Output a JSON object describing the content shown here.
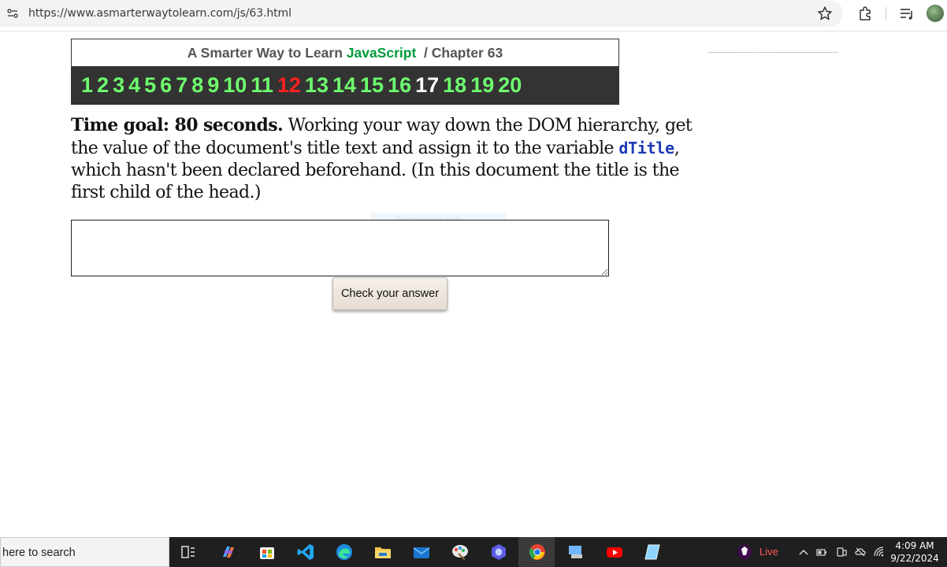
{
  "browser": {
    "url": "https://www.asmarterwaytolearn.com/js/63.html"
  },
  "header": {
    "title_prefix": "A Smarter Way to Learn ",
    "title_brand": "JavaScript",
    "title_suffix": "/  Chapter 63",
    "brand_color": "#009b3a"
  },
  "chapters": [
    {
      "label": "1",
      "state": "todo"
    },
    {
      "label": "2",
      "state": "todo"
    },
    {
      "label": "3",
      "state": "todo"
    },
    {
      "label": "4",
      "state": "todo"
    },
    {
      "label": "5",
      "state": "todo"
    },
    {
      "label": "6",
      "state": "todo"
    },
    {
      "label": "7",
      "state": "todo"
    },
    {
      "label": "8",
      "state": "todo"
    },
    {
      "label": "9",
      "state": "todo"
    },
    {
      "label": "10",
      "state": "todo"
    },
    {
      "label": "11",
      "state": "todo"
    },
    {
      "label": "12",
      "state": "done"
    },
    {
      "label": "13",
      "state": "todo"
    },
    {
      "label": "14",
      "state": "todo"
    },
    {
      "label": "15",
      "state": "todo"
    },
    {
      "label": "16",
      "state": "todo"
    },
    {
      "label": "17",
      "state": "current"
    },
    {
      "label": "18",
      "state": "todo"
    },
    {
      "label": "19",
      "state": "todo"
    },
    {
      "label": "20",
      "state": "todo"
    }
  ],
  "exercise": {
    "goal": "Time goal: 80 seconds.",
    "text_before": " Working your way down the DOM hierarchy, get the value of the document's title text and assign it to the variable ",
    "variable": "dTitle",
    "text_after": ", which hasn't been declared beforehand. (In this document the title is the first child of the head.)",
    "answer_value": "",
    "check_label": "Check your answer"
  },
  "overlay": {
    "ghost_label": "Rectangular Snip"
  },
  "taskbar": {
    "search_placeholder": "here to search",
    "live_label": "Live",
    "time": "4:09 AM",
    "date": "9/22/2024"
  }
}
